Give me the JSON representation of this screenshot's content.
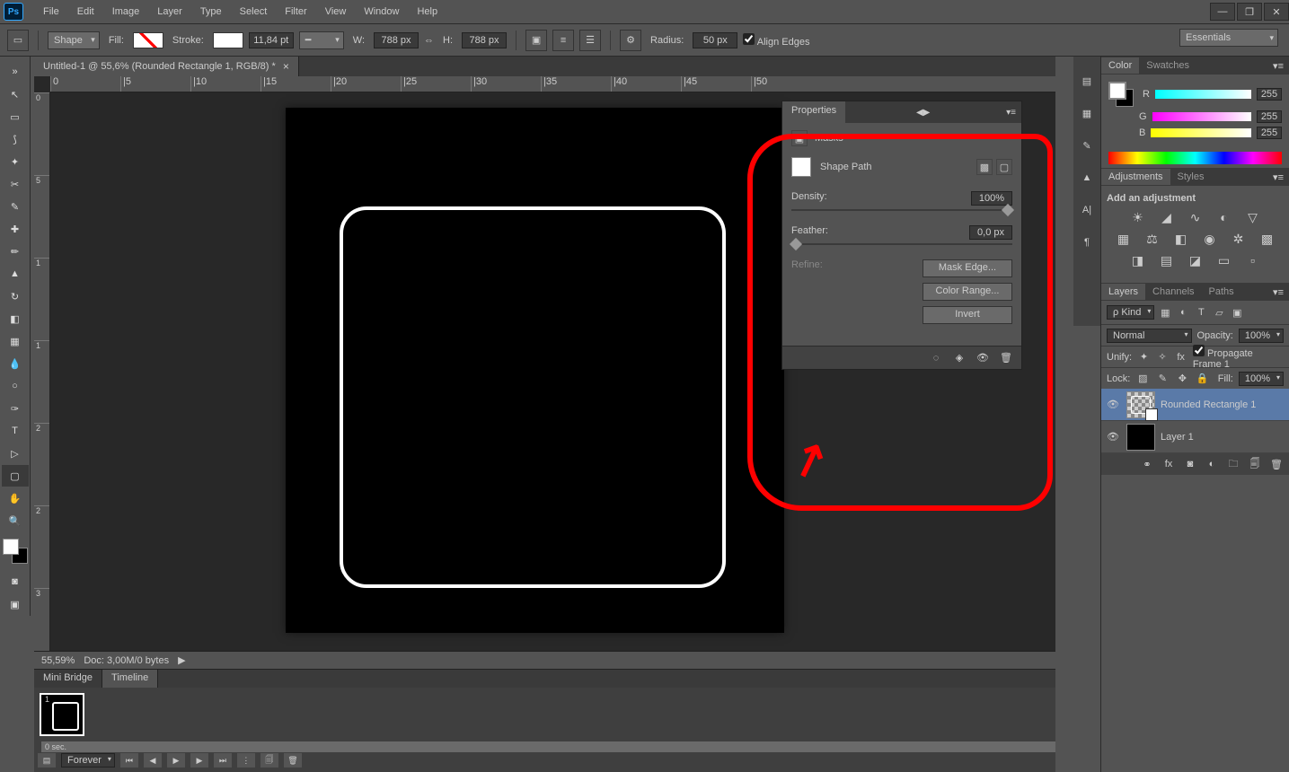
{
  "menu": {
    "items": [
      "File",
      "Edit",
      "Image",
      "Layer",
      "Type",
      "Select",
      "Filter",
      "View",
      "Window",
      "Help"
    ]
  },
  "workspace": "Essentials",
  "doc_tab": "Untitled-1 @ 55,6% (Rounded Rectangle 1, RGB/8) *",
  "options": {
    "mode": "Shape",
    "fill_label": "Fill:",
    "stroke_label": "Stroke:",
    "stroke_pt": "11,84 pt",
    "w_label": "W:",
    "w": "788 px",
    "h_label": "H:",
    "h": "788 px",
    "radius_label": "Radius:",
    "radius": "50 px",
    "align_edges": "Align Edges"
  },
  "ruler_h": [
    ".|",
    "0",
    "|5",
    "|10",
    "|15",
    "|20",
    "|25",
    "|30",
    "|35",
    "|40",
    "|45",
    "|50"
  ],
  "ruler_v": [
    "0",
    "5",
    "1",
    "1",
    "2",
    "2",
    "3"
  ],
  "status": {
    "zoom": "55,59%",
    "doc_info": "Doc: 3,00M/0 bytes"
  },
  "bottom_tabs": {
    "a": "Mini Bridge",
    "b": "Timeline"
  },
  "timeline": {
    "sec": "0 sec.",
    "forever": "Forever"
  },
  "properties": {
    "title": "Properties",
    "masks": "Masks",
    "shape_path": "Shape Path",
    "density_label": "Density:",
    "density_val": "100%",
    "feather_label": "Feather:",
    "feather_val": "0,0 px",
    "refine_label": "Refine:",
    "btn_mask_edge": "Mask Edge...",
    "btn_color_range": "Color Range...",
    "btn_invert": "Invert"
  },
  "color_panel": {
    "tab_color": "Color",
    "tab_swatches": "Swatches",
    "r": "R",
    "g": "G",
    "b": "B",
    "val": "255"
  },
  "adjustments": {
    "tab_adj": "Adjustments",
    "tab_styles": "Styles",
    "add_label": "Add an adjustment"
  },
  "layers": {
    "tab_layers": "Layers",
    "tab_channels": "Channels",
    "tab_paths": "Paths",
    "kind": "Kind",
    "normal": "Normal",
    "opacity_label": "Opacity:",
    "opacity": "100%",
    "unify": "Unify:",
    "propagate": "Propagate Frame 1",
    "lock": "Lock:",
    "fill_label": "Fill:",
    "fill": "100%",
    "layer1": "Rounded Rectangle 1",
    "layer2": "Layer 1"
  }
}
